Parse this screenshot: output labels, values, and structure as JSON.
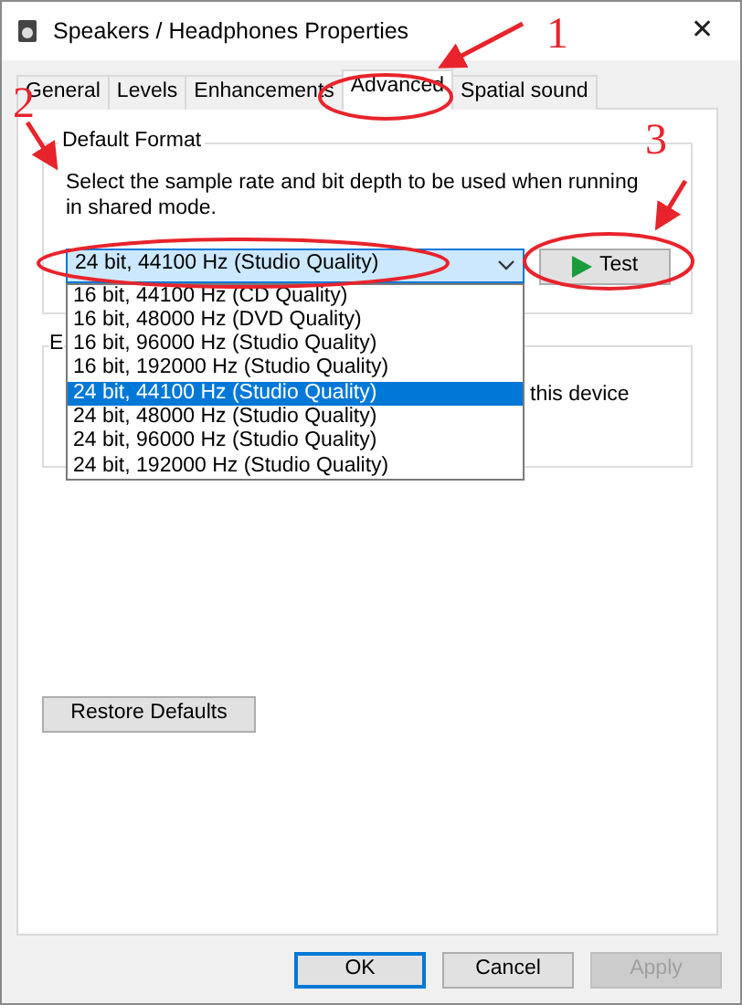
{
  "window": {
    "title": "Speakers / Headphones Properties",
    "close": "✕"
  },
  "tabs": [
    {
      "label": "General",
      "selected": false
    },
    {
      "label": "Levels",
      "selected": false
    },
    {
      "label": "Enhancements",
      "selected": false
    },
    {
      "label": "Advanced",
      "selected": true
    },
    {
      "label": "Spatial sound",
      "selected": false
    }
  ],
  "default_format": {
    "title": "Default Format",
    "description": "Select the sample rate and bit depth to be used when running in shared mode.",
    "combo": {
      "value": "24 bit, 44100 Hz (Studio Quality)",
      "expanded": true,
      "options": [
        {
          "label": "16 bit, 44100 Hz (CD Quality)",
          "selected": false
        },
        {
          "label": "16 bit, 48000 Hz (DVD Quality)",
          "selected": false
        },
        {
          "label": "16 bit, 96000 Hz (Studio Quality)",
          "selected": false
        },
        {
          "label": "16 bit, 192000 Hz (Studio Quality)",
          "selected": false
        },
        {
          "label": "24 bit, 44100 Hz (Studio Quality)",
          "selected": true
        },
        {
          "label": "24 bit, 48000 Hz (Studio Quality)",
          "selected": false
        },
        {
          "label": "24 bit, 96000 Hz (Studio Quality)",
          "selected": false
        },
        {
          "label": "24 bit, 192000 Hz (Studio Quality)",
          "selected": false
        }
      ]
    },
    "test_button": "Test"
  },
  "second_group": {
    "title": "E",
    "text": "this device"
  },
  "restore_button": "Restore Defaults",
  "buttons": [
    {
      "label": "OK",
      "default": true,
      "disabled": false
    },
    {
      "label": "Cancel",
      "default": false,
      "disabled": false
    },
    {
      "label": "Apply",
      "default": false,
      "disabled": true
    }
  ],
  "annotations": [
    {
      "label": "1"
    },
    {
      "label": "2"
    },
    {
      "label": "3"
    }
  ]
}
